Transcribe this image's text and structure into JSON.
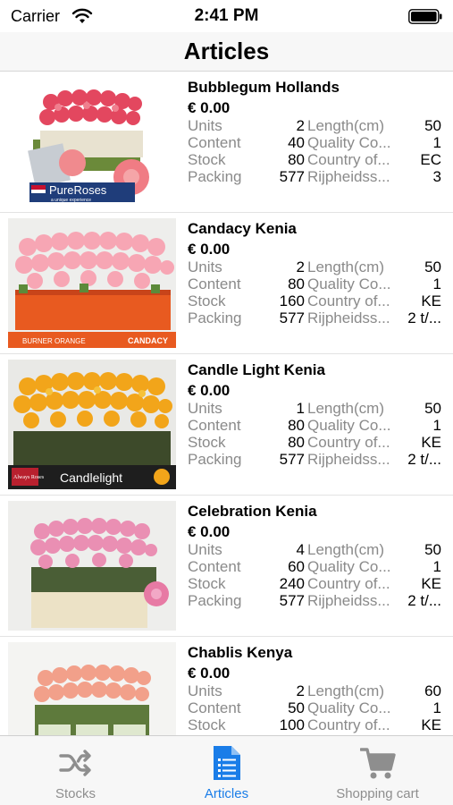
{
  "status_bar": {
    "carrier": "Carrier",
    "time": "2:41 PM"
  },
  "nav": {
    "title": "Articles"
  },
  "articles": [
    {
      "name": "Bubblegum Hollands",
      "price": "€ 0.00",
      "rows": [
        [
          "Units",
          "2",
          "Length(cm)",
          "50"
        ],
        [
          "Content",
          "40",
          "Quality Co...",
          "1"
        ],
        [
          "Stock",
          "80",
          "Country of...",
          "EC"
        ],
        [
          "Packing",
          "577",
          "Rijpheidss...",
          "3"
        ]
      ],
      "image_caption": "PureRoses",
      "image_subcaption": "a unique experience"
    },
    {
      "name": "Candacy Kenia",
      "price": "€ 0.00",
      "rows": [
        [
          "Units",
          "2",
          "Length(cm)",
          "50"
        ],
        [
          "Content",
          "80",
          "Quality Co...",
          "1"
        ],
        [
          "Stock",
          "160",
          "Country of...",
          "KE"
        ],
        [
          "Packing",
          "577",
          "Rijpheidss...",
          "2 t/..."
        ]
      ],
      "image_caption": "BURNER ORANGE",
      "image_subcaption": "CANDACY"
    },
    {
      "name": "Candle Light Kenia",
      "price": "€ 0.00",
      "rows": [
        [
          "Units",
          "1",
          "Length(cm)",
          "50"
        ],
        [
          "Content",
          "80",
          "Quality Co...",
          "1"
        ],
        [
          "Stock",
          "80",
          "Country of...",
          "KE"
        ],
        [
          "Packing",
          "577",
          "Rijpheidss...",
          "2 t/..."
        ]
      ],
      "image_caption": "Candlelight",
      "image_subcaption": "Always Roses"
    },
    {
      "name": "Celebration Kenia",
      "price": "€ 0.00",
      "rows": [
        [
          "Units",
          "4",
          "Length(cm)",
          "50"
        ],
        [
          "Content",
          "60",
          "Quality Co...",
          "1"
        ],
        [
          "Stock",
          "240",
          "Country of...",
          "KE"
        ],
        [
          "Packing",
          "577",
          "Rijpheidss...",
          "2 t/..."
        ]
      ]
    },
    {
      "name": "Chablis Kenya",
      "price": "€ 0.00",
      "rows": [
        [
          "Units",
          "2",
          "Length(cm)",
          "60"
        ],
        [
          "Content",
          "50",
          "Quality Co...",
          "1"
        ],
        [
          "Stock",
          "100",
          "Country of...",
          "KE"
        ]
      ]
    }
  ],
  "tabs": [
    {
      "label": "Stocks",
      "icon": "shuffle-icon",
      "active": false
    },
    {
      "label": "Articles",
      "icon": "document-list-icon",
      "active": true
    },
    {
      "label": "Shopping cart",
      "icon": "cart-icon",
      "active": false
    }
  ],
  "colors": {
    "accent": "#1a7de8",
    "inactive": "#8e8e8e",
    "label_gray": "#8a8a8a"
  }
}
